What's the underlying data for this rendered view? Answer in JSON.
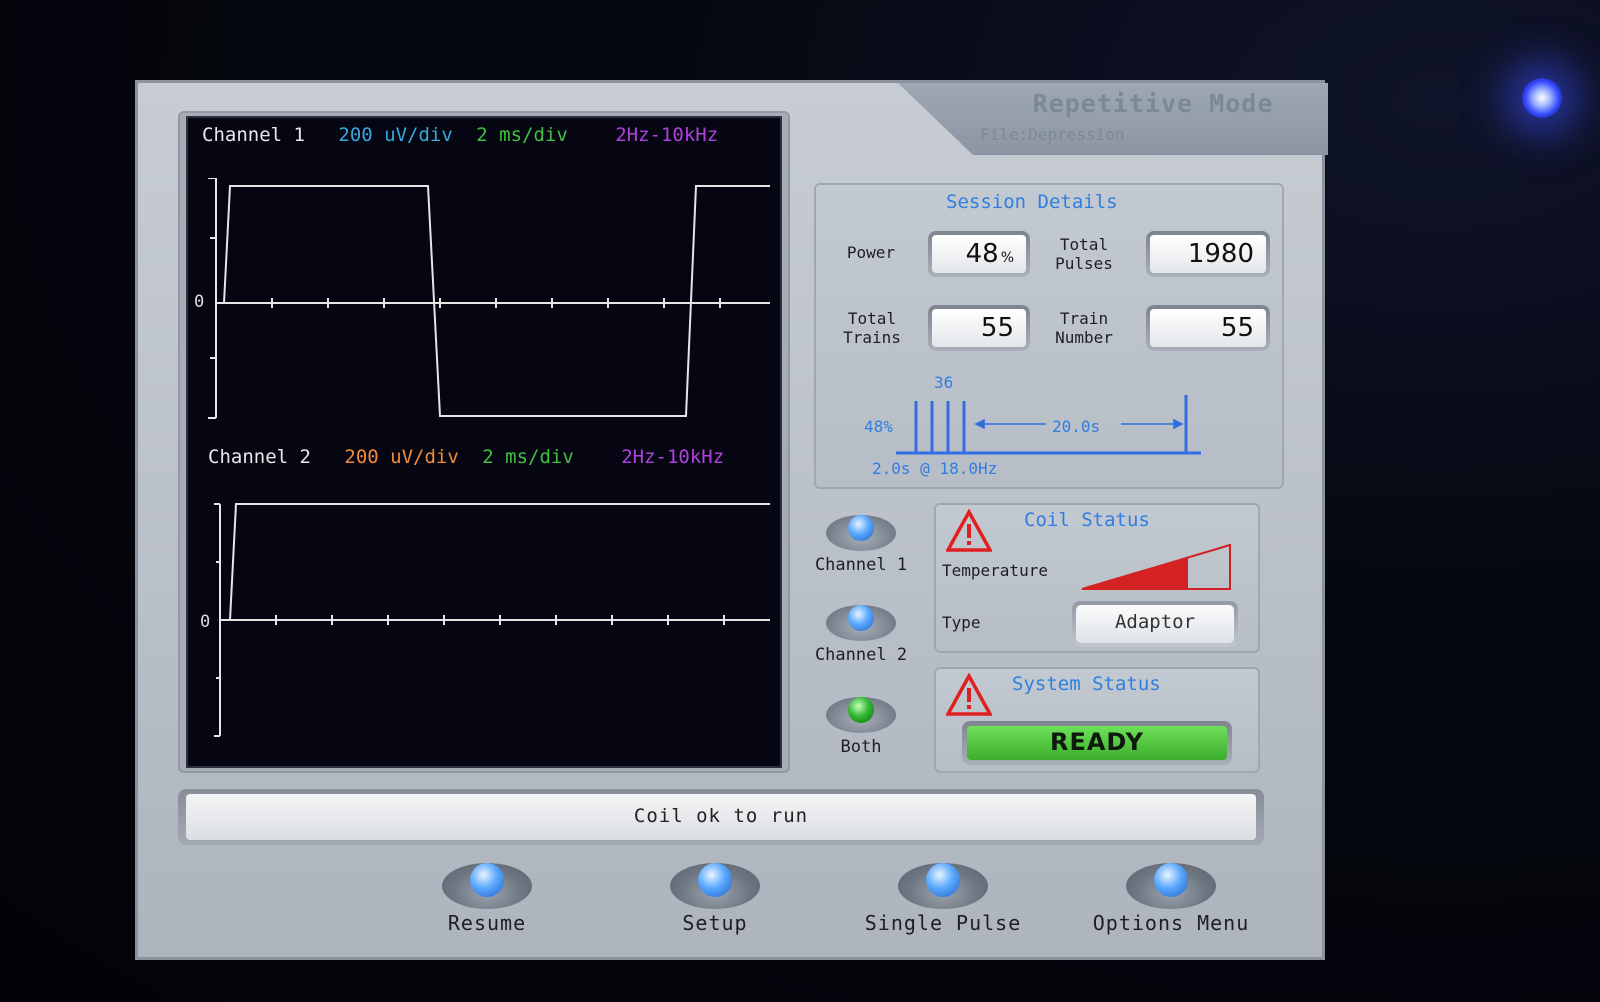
{
  "header": {
    "title": "Repetitive Mode",
    "file": "File:Depression"
  },
  "scope": {
    "channel1": {
      "name": "Channel 1",
      "scale_v": "200 uV/div",
      "scale_t": "2 ms/div",
      "filter": "2Hz-10kHz",
      "zero": "0"
    },
    "channel2": {
      "name": "Channel 2",
      "scale_v": "200 uV/div",
      "scale_t": "2 ms/div",
      "filter": "2Hz-10kHz",
      "zero": "0"
    }
  },
  "session": {
    "title": "Session Details",
    "power_label": "Power",
    "power_value": "48",
    "power_unit": "%",
    "total_pulses_label": "Total Pulses",
    "total_pulses_value": "1980",
    "total_trains_label": "Total Trains",
    "total_trains_value": "55",
    "train_number_label": "Train Number",
    "train_number_value": "55",
    "diagram": {
      "pulses": "36",
      "power": "48%",
      "interval": "20.0s",
      "train": "2.0s @ 18.0Hz"
    }
  },
  "channel_select": {
    "items": [
      {
        "label": "Channel 1",
        "color": "#4a9cff"
      },
      {
        "label": "Channel 2",
        "color": "#4a9cff"
      },
      {
        "label": "Both",
        "color": "#2fb82f"
      }
    ]
  },
  "coil_status": {
    "title": "Coil Status",
    "temperature_label": "Temperature",
    "type_label": "Type",
    "type_value": "Adaptor"
  },
  "system_status": {
    "title": "System Status",
    "state": "READY",
    "state_color": "#3cae2c"
  },
  "status_message": "Coil ok to run",
  "softkeys": [
    "Resume",
    "Setup",
    "Single Pulse",
    "Options Menu"
  ]
}
